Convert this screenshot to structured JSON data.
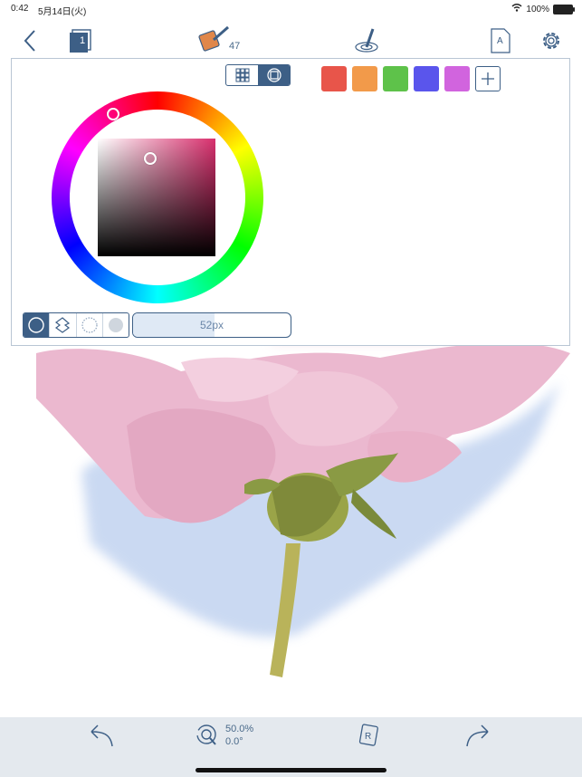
{
  "status_bar": {
    "time": "0:42",
    "date": "5月14日(火)",
    "battery": "100%"
  },
  "toolbar": {
    "layer_number": "1",
    "brush_count": "47",
    "back_icon": "chevron-left-icon",
    "layers_icon": "layers-icon",
    "brush_icon": "brush-icon",
    "blend_icon": "blend-tool-icon",
    "document_icon": "document-icon",
    "settings_icon": "gear-icon"
  },
  "color_panel": {
    "mode_tabs": [
      {
        "icon": "grid-icon",
        "selected": false
      },
      {
        "icon": "wheel-icon",
        "selected": true
      }
    ],
    "swatches": [
      {
        "color": "#e8554a"
      },
      {
        "color": "#f29a4a"
      },
      {
        "color": "#5ec24a"
      },
      {
        "color": "#5a55ec"
      },
      {
        "color": "#d164de"
      }
    ],
    "current_color": "#e9b8cc",
    "brush_types": [
      {
        "icon": "round-brush-icon",
        "selected": true
      },
      {
        "icon": "textured-brush-icon",
        "selected": false
      },
      {
        "icon": "soft-brush-icon",
        "selected": false
      },
      {
        "icon": "filled-brush-icon",
        "selected": false
      }
    ],
    "size_label": "52px",
    "size_fraction": 0.52
  },
  "bottom_bar": {
    "zoom": "50.0%",
    "rotation": "0.0°"
  }
}
